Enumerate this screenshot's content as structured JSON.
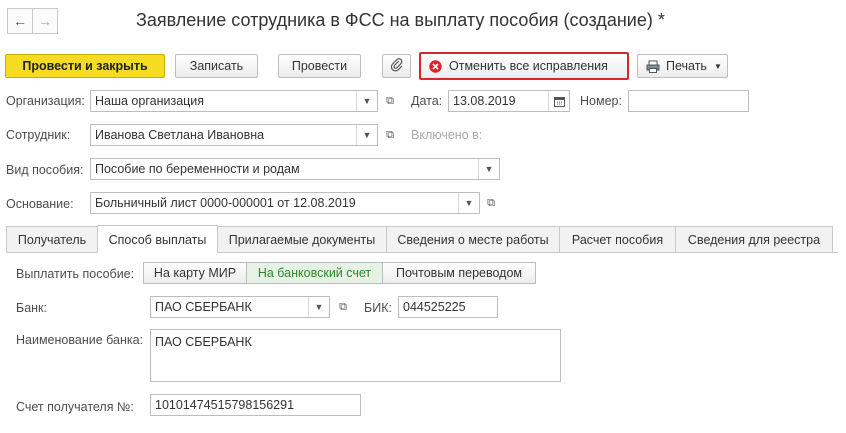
{
  "window": {
    "title": "Заявление сотрудника в ФСС на выплату пособия (создание) *",
    "back_icon": "←",
    "forward_icon": "→"
  },
  "toolbar": {
    "post_close": "Провести и закрыть",
    "save": "Записать",
    "post": "Провести",
    "cancel_corrections": "Отменить все исправления",
    "print": "Печать"
  },
  "form": {
    "org_label": "Организация:",
    "org_value": "Наша организация",
    "date_label": "Дата:",
    "date_value": "13.08.2019",
    "number_label": "Номер:",
    "number_value": "",
    "employee_label": "Сотрудник:",
    "employee_value": "Иванова Светлана Ивановна",
    "included_label": "Включено в:",
    "benefit_label": "Вид пособия:",
    "benefit_value": "Пособие по беременности и родам",
    "basis_label": "Основание:",
    "basis_value": "Больничный лист 0000-000001 от 12.08.2019"
  },
  "tabs": [
    {
      "label": "Получатель"
    },
    {
      "label": "Способ выплаты"
    },
    {
      "label": "Прилагаемые документы"
    },
    {
      "label": "Сведения о месте работы"
    },
    {
      "label": "Расчет пособия"
    },
    {
      "label": "Сведения для реестра"
    }
  ],
  "payment": {
    "pay_label": "Выплатить пособие:",
    "options": [
      "На карту МИР",
      "На банковский счет",
      "Почтовым переводом"
    ],
    "selected": "На банковский счет",
    "bank_label": "Банк:",
    "bank_value": "ПАО СБЕРБАНК",
    "bik_label": "БИК:",
    "bik_value": "044525225",
    "bank_name_label": "Наименование банка:",
    "bank_name_value": "ПАО СБЕРБАНК",
    "account_label": "Счет получателя №:",
    "account_value": "10101474515798156291"
  },
  "colors": {
    "primary_button": "#f5db22",
    "highlight_border": "#d9262c",
    "selected_option": "#2a8a2a",
    "cancel_icon": "#d9262c"
  }
}
